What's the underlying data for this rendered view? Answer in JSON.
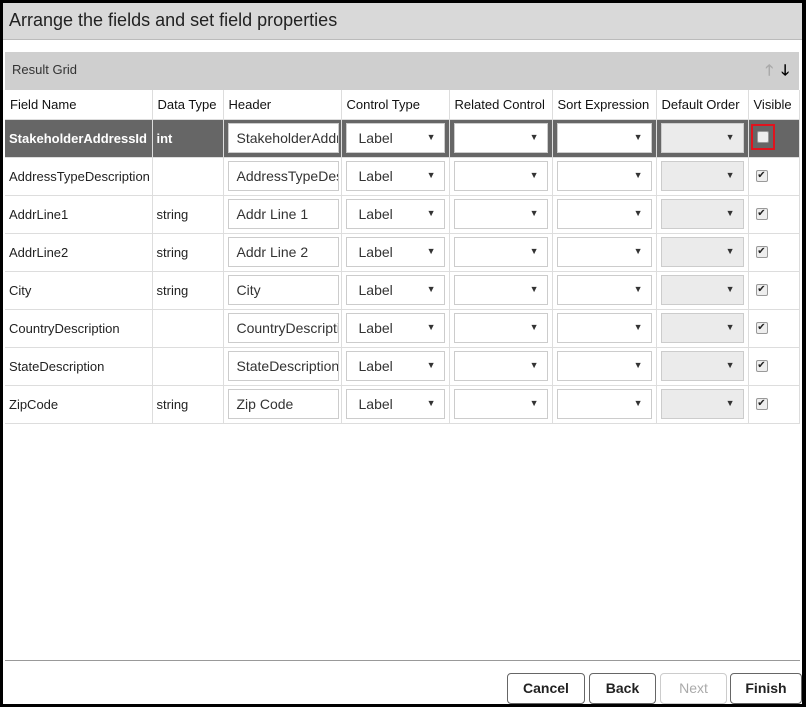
{
  "title": "Arrange the fields and set field properties",
  "grid": {
    "label": "Result Grid",
    "move_up_icon": "arrow-up-icon",
    "move_down_icon": "arrow-down-icon"
  },
  "columns": [
    "Field Name",
    "Data Type",
    "Header",
    "Control Type",
    "Related Control",
    "Sort Expression",
    "Default Order",
    "Visible"
  ],
  "rows": [
    {
      "field": "StakeholderAddressId",
      "type": "int",
      "header": "StakeholderAddressId",
      "control": "Label",
      "visible": false,
      "selected": true
    },
    {
      "field": "AddressTypeDescription",
      "type": "",
      "header": "AddressTypeDescription",
      "control": "Label",
      "visible": true
    },
    {
      "field": "AddrLine1",
      "type": "string",
      "header": "Addr Line 1",
      "control": "Label",
      "visible": true
    },
    {
      "field": "AddrLine2",
      "type": "string",
      "header": "Addr Line 2",
      "control": "Label",
      "visible": true
    },
    {
      "field": "City",
      "type": "string",
      "header": "City",
      "control": "Label",
      "visible": true
    },
    {
      "field": "CountryDescription",
      "type": "",
      "header": "CountryDescription",
      "control": "Label",
      "visible": true
    },
    {
      "field": "StateDescription",
      "type": "",
      "header": "StateDescription",
      "control": "Label",
      "visible": true
    },
    {
      "field": "ZipCode",
      "type": "string",
      "header": "Zip Code",
      "control": "Label",
      "visible": true
    }
  ],
  "buttons": {
    "cancel": "Cancel",
    "back": "Back",
    "next": "Next",
    "finish": "Finish"
  },
  "colors": {
    "selected_row": "#666666",
    "highlight": "#e0141e"
  }
}
